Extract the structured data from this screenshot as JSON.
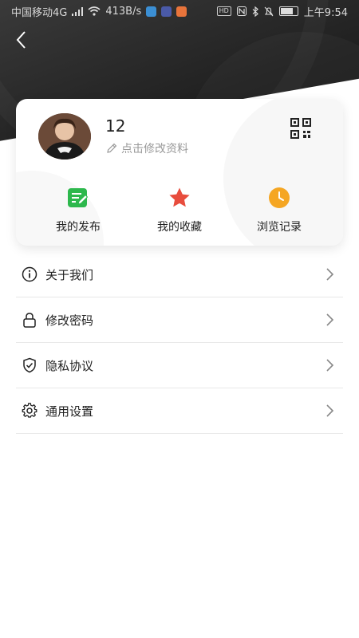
{
  "status_bar": {
    "carrier": "中国移动4G",
    "network_sup": "4G",
    "speed": "413B/s",
    "hd": "HD",
    "time": "上午9:54"
  },
  "profile": {
    "username": "12",
    "edit_prompt": "点击修改资料"
  },
  "quick_actions": [
    {
      "label": "我的发布",
      "icon": "edit-note-icon",
      "color": "#2db84d"
    },
    {
      "label": "我的收藏",
      "icon": "star-icon",
      "color": "#e84d3d"
    },
    {
      "label": "浏览记录",
      "icon": "clock-icon",
      "color": "#f5a623"
    }
  ],
  "menu": [
    {
      "label": "关于我们",
      "icon": "info-icon"
    },
    {
      "label": "修改密码",
      "icon": "lock-icon"
    },
    {
      "label": "隐私协议",
      "icon": "shield-icon"
    },
    {
      "label": "通用设置",
      "icon": "gear-icon"
    }
  ],
  "colors": {
    "header_bg": "#1f1f1f",
    "card_bg": "#ffffff",
    "text_primary": "#222222",
    "text_secondary": "#999999"
  }
}
